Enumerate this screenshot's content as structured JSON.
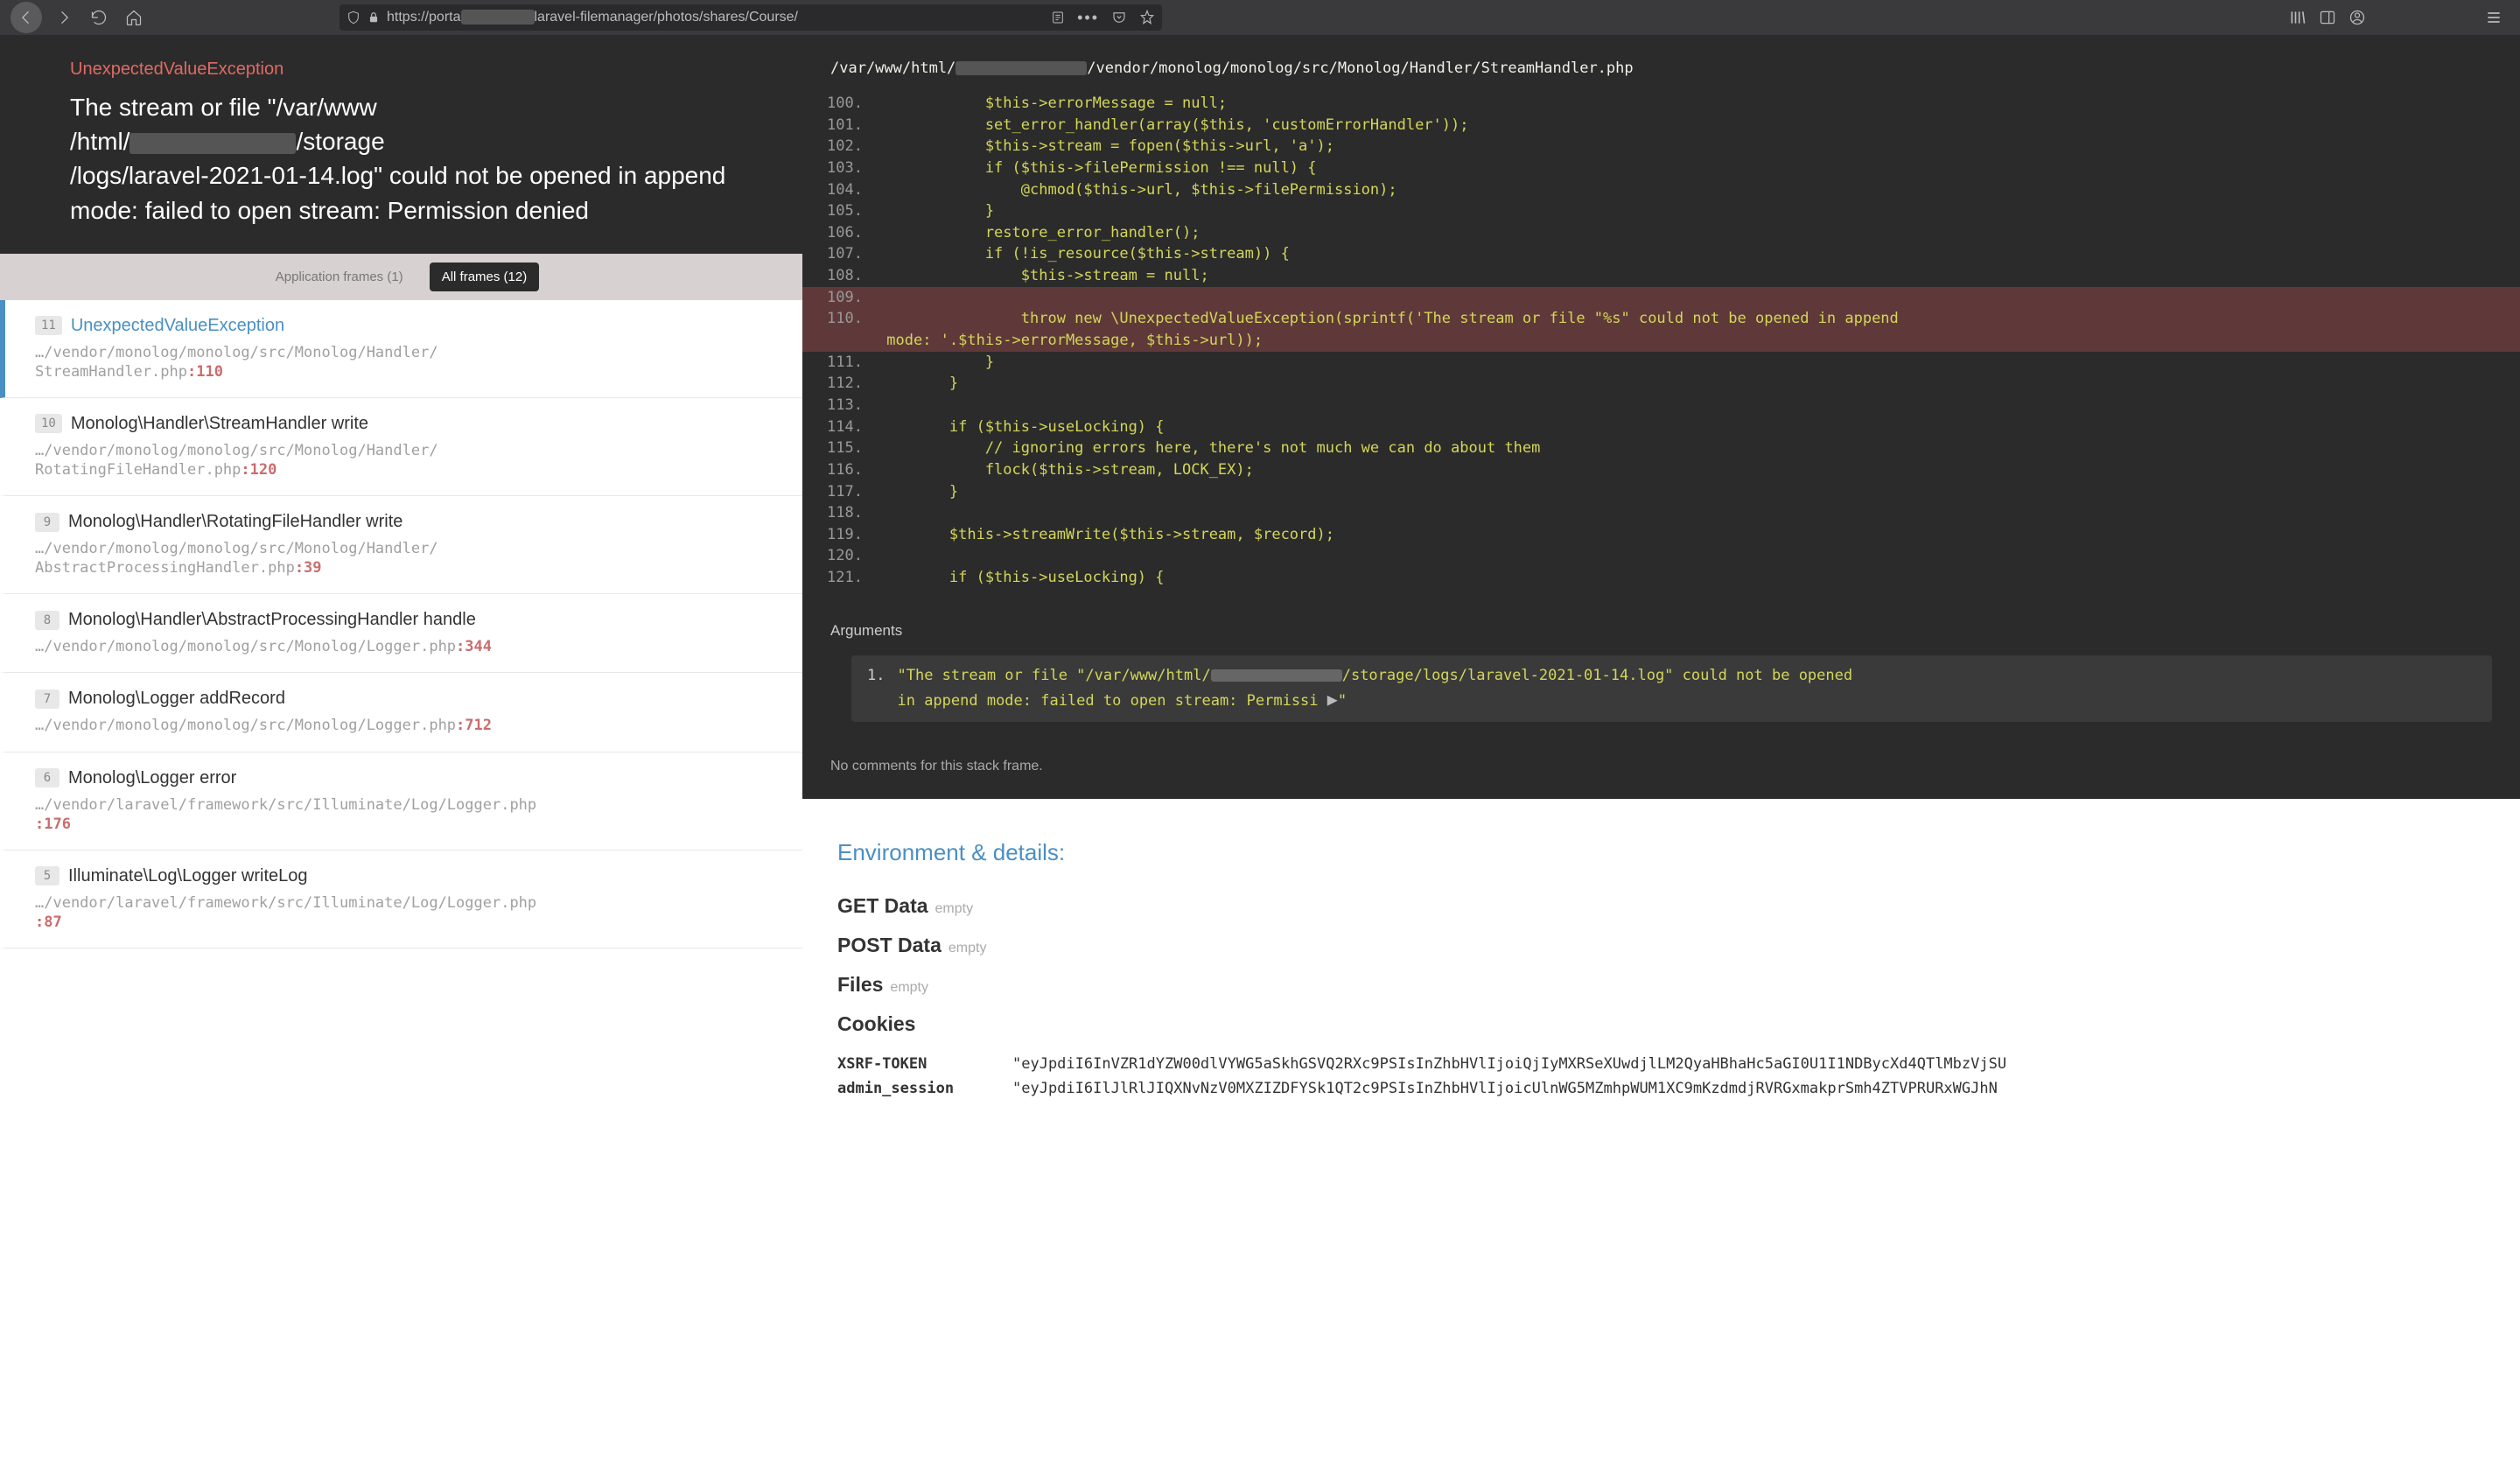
{
  "browser": {
    "url_prefix": "https://porta",
    "url_suffix": "laravel-filemanager/photos/shares/Course/"
  },
  "error": {
    "class": "UnexpectedValueException",
    "message_pre": "The stream or file \"/var/www\n/html/",
    "message_post": "/storage\n/logs/laravel-2021-01-14.log\" could not be opened in append mode: failed to open stream: Permission denied"
  },
  "tabs": {
    "app": "Application frames (1)",
    "all": "All frames (12)"
  },
  "frames": [
    {
      "num": "11",
      "title": "UnexpectedValueException",
      "path": "…/vendor/monolog/monolog/src/Monolog/Handler/\nStreamHandler.php",
      "line": "110",
      "active": true,
      "exc": true
    },
    {
      "num": "10",
      "title": "Monolog\\Handler\\StreamHandler write",
      "path": "…/vendor/monolog/monolog/src/Monolog/Handler/\nRotatingFileHandler.php",
      "line": "120"
    },
    {
      "num": "9",
      "title": "Monolog\\Handler\\RotatingFileHandler write",
      "path": "…/vendor/monolog/monolog/src/Monolog/Handler/\nAbstractProcessingHandler.php",
      "line": "39"
    },
    {
      "num": "8",
      "title": "Monolog\\Handler\\AbstractProcessingHandler handle",
      "path": "…/vendor/monolog/monolog/src/Monolog/Logger.php",
      "line": "344"
    },
    {
      "num": "7",
      "title": "Monolog\\Logger addRecord",
      "path": "…/vendor/monolog/monolog/src/Monolog/Logger.php",
      "line": "712"
    },
    {
      "num": "6",
      "title": "Monolog\\Logger error",
      "path": "…/vendor/laravel/framework/src/Illuminate/Log/Logger.php\n",
      "line": "176"
    },
    {
      "num": "5",
      "title": "Illuminate\\Log\\Logger writeLog",
      "path": "…/vendor/laravel/framework/src/Illuminate/Log/Logger.php\n",
      "line": "87"
    }
  ],
  "code": {
    "file_pre": "/var/www/html/",
    "file_post": "/vendor/monolog/monolog/src/Monolog/Handler/StreamHandler.php",
    "lines": [
      {
        "n": "100",
        "t": "            $this->errorMessage = null;"
      },
      {
        "n": "101",
        "t": "            set_error_handler(array($this, 'customErrorHandler'));"
      },
      {
        "n": "102",
        "t": "            $this->stream = fopen($this->url, 'a');"
      },
      {
        "n": "103",
        "t": "            if ($this->filePermission !== null) {"
      },
      {
        "n": "104",
        "t": "                @chmod($this->url, $this->filePermission);"
      },
      {
        "n": "105",
        "t": "            }"
      },
      {
        "n": "106",
        "t": "            restore_error_handler();"
      },
      {
        "n": "107",
        "t": "            if (!is_resource($this->stream)) {"
      },
      {
        "n": "108",
        "t": "                $this->stream = null;"
      },
      {
        "n": "109",
        "t": "",
        "hl": true
      },
      {
        "n": "110",
        "t": "                throw new \\UnexpectedValueException(sprintf('The stream or file \"%s\" could not be opened in append",
        "hl": true,
        "cont": " mode: '.$this->errorMessage, $this->url));"
      },
      {
        "n": "111",
        "t": "            }"
      },
      {
        "n": "112",
        "t": "        }"
      },
      {
        "n": "113",
        "t": ""
      },
      {
        "n": "114",
        "t": "        if ($this->useLocking) {"
      },
      {
        "n": "115",
        "t": "            // ignoring errors here, there's not much we can do about them"
      },
      {
        "n": "116",
        "t": "            flock($this->stream, LOCK_EX);"
      },
      {
        "n": "117",
        "t": "        }"
      },
      {
        "n": "118",
        "t": ""
      },
      {
        "n": "119",
        "t": "        $this->streamWrite($this->stream, $record);"
      },
      {
        "n": "120",
        "t": ""
      },
      {
        "n": "121",
        "t": "        if ($this->useLocking) {"
      }
    ]
  },
  "args": {
    "label": "Arguments",
    "num": "1.",
    "val_pre": "\"The stream or file \"/var/www/html/",
    "val_post": "/storage/logs/laravel-2021-01-14.log\" could not be opened\n   in append mode: failed to open stream: Permissi ",
    "val_end": "\""
  },
  "comments": "No comments for this stack frame.",
  "env": {
    "heading": "Environment & details:",
    "getdata": "GET Data",
    "postdata": "POST Data",
    "files": "Files",
    "cookies": "Cookies",
    "empty": "empty",
    "cookie_rows": [
      {
        "k": "XSRF-TOKEN",
        "v": "\"eyJpdiI6InVZR1dYZW00dlVYWG5aSkhGSVQ2RXc9PSIsInZhbHVlIjoiQjIyMXRSeXUwdjlLM2QyaHBhaHc5aGI0U1I1NDBycXd4QTlMbzVjSU"
      },
      {
        "k": "admin_session",
        "v": "\"eyJpdiI6IlJlRlJIQXNvNzV0MXZIZDFYSk1QT2c9PSIsInZhbHVlIjoicUlnWG5MZmhpWUM1XC9mKzdmdjRVRGxmakprSmh4ZTVPRURxWGJhN"
      }
    ]
  }
}
